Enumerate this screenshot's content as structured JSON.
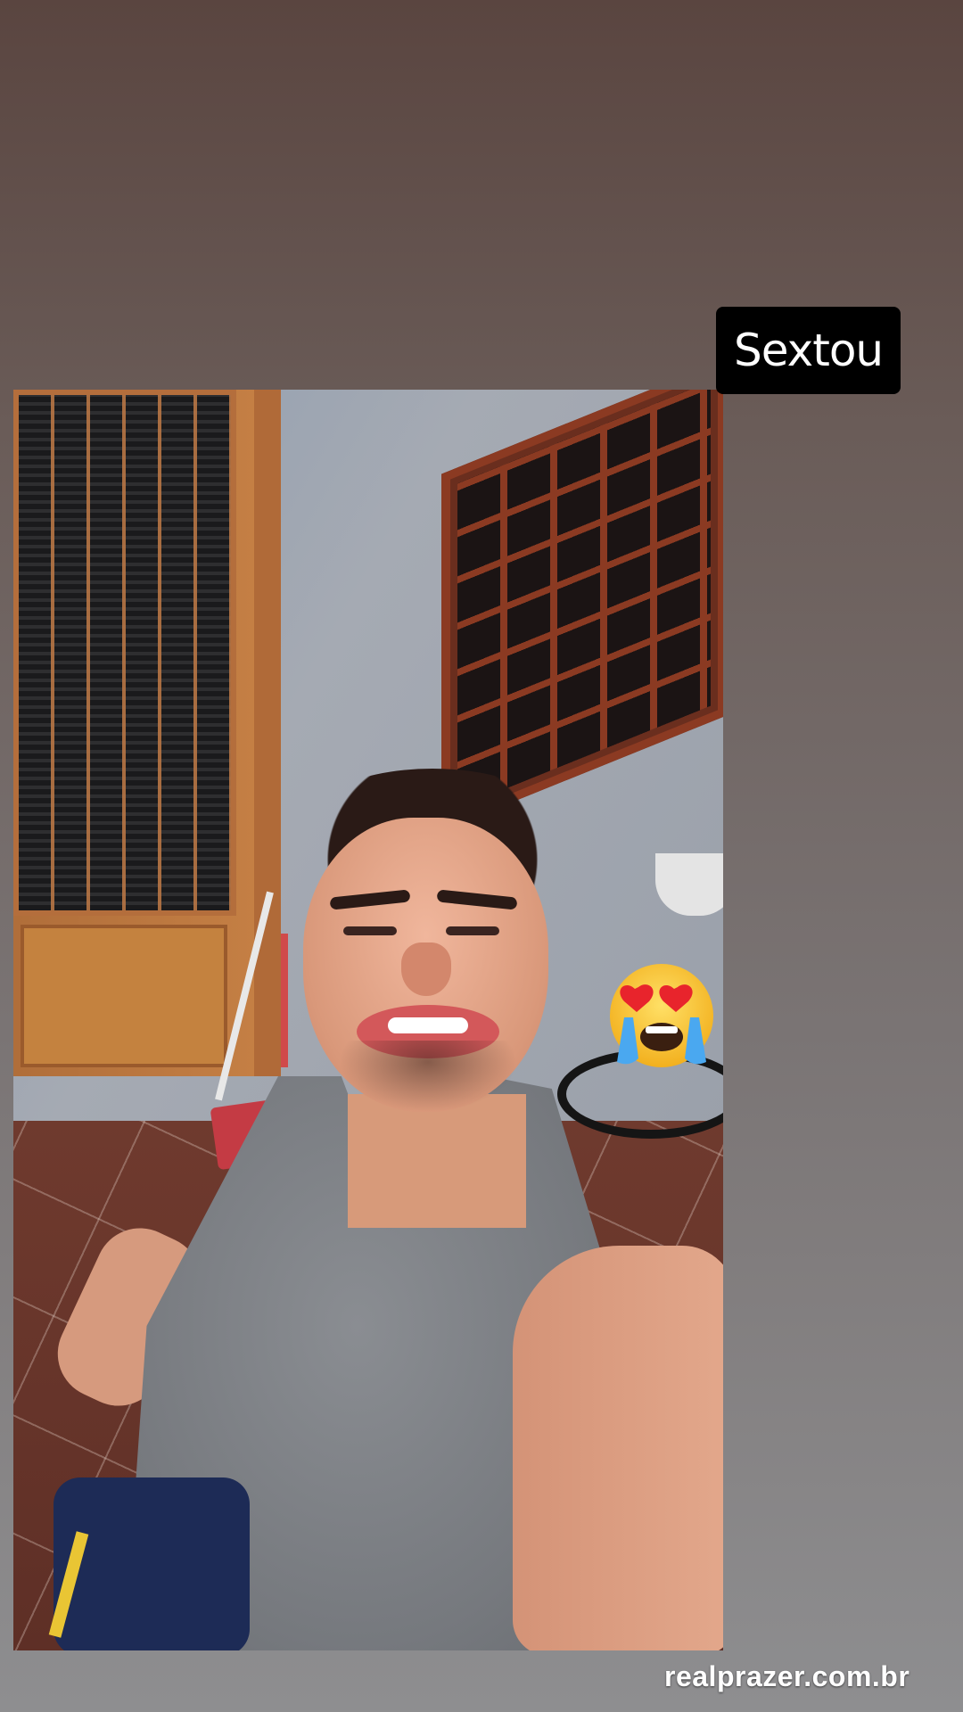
{
  "story": {
    "caption_sticker": "Sextou",
    "emoji": "smiling-face-with-heart-eyes-crying-icon"
  },
  "watermark": {
    "text": "realprazer.com.br"
  },
  "colors": {
    "background_top": "#5a4540",
    "background_bottom": "#8e8e90",
    "sticker_background": "#000000",
    "sticker_text": "#ffffff"
  }
}
